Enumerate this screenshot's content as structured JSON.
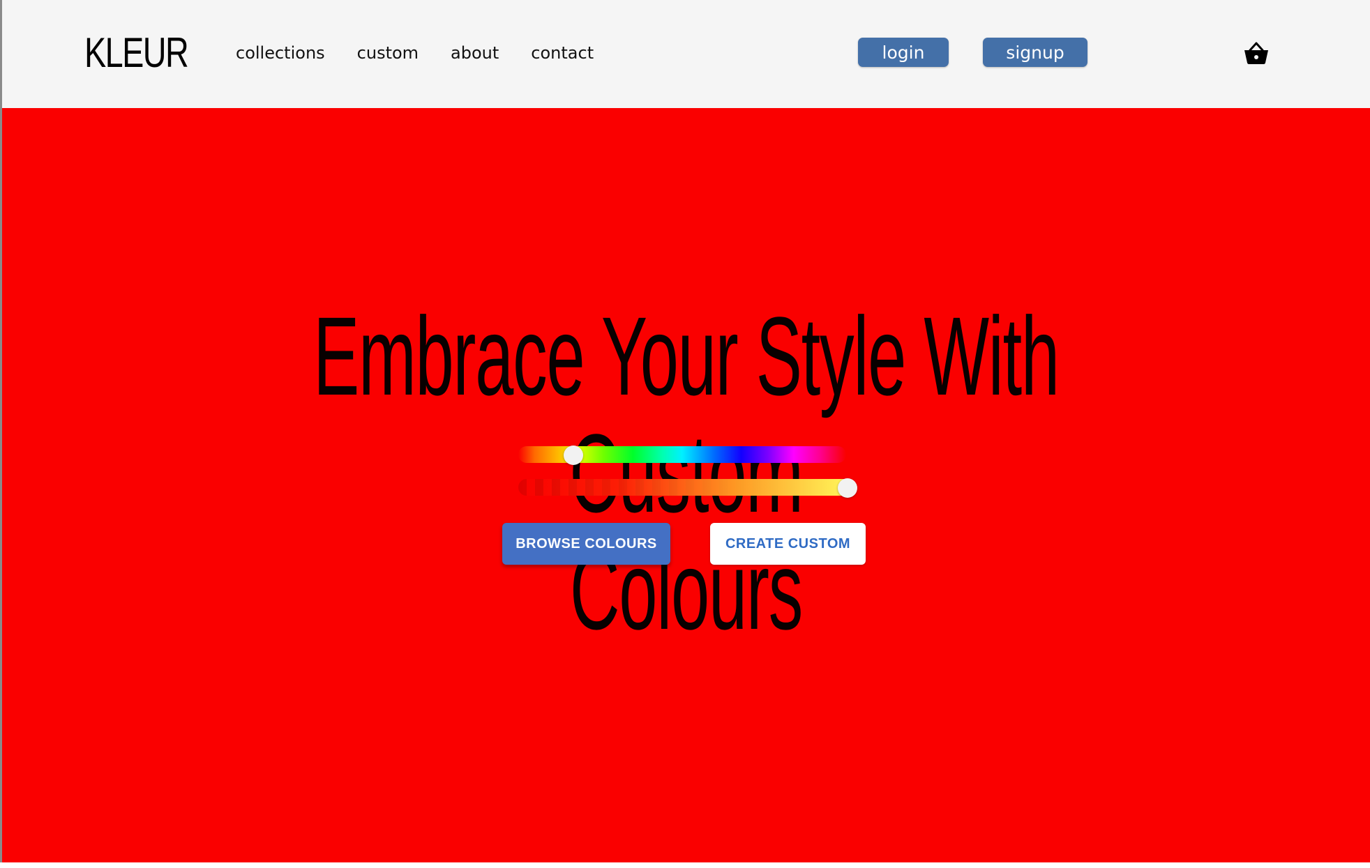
{
  "header": {
    "logo": "KLEUR",
    "nav": [
      {
        "label": "collections"
      },
      {
        "label": "custom"
      },
      {
        "label": "about"
      },
      {
        "label": "contact"
      }
    ],
    "login_label": "login",
    "signup_label": "signup",
    "cart_icon": "basket-icon"
  },
  "hero": {
    "title": "Embrace Your Style With Custom\nColours",
    "hue_slider_value": 0.17,
    "alpha_slider_value": 1.0,
    "browse_label": "BROWSE COLOURS",
    "create_label": "CREATE CUSTOM"
  },
  "colors": {
    "navbar_bg": "#f5f5f5",
    "hero_bg": "#fa0000",
    "auth_button": "#4470a8",
    "primary_button": "#4470c4",
    "secondary_button_text": "#2f6bc4"
  }
}
